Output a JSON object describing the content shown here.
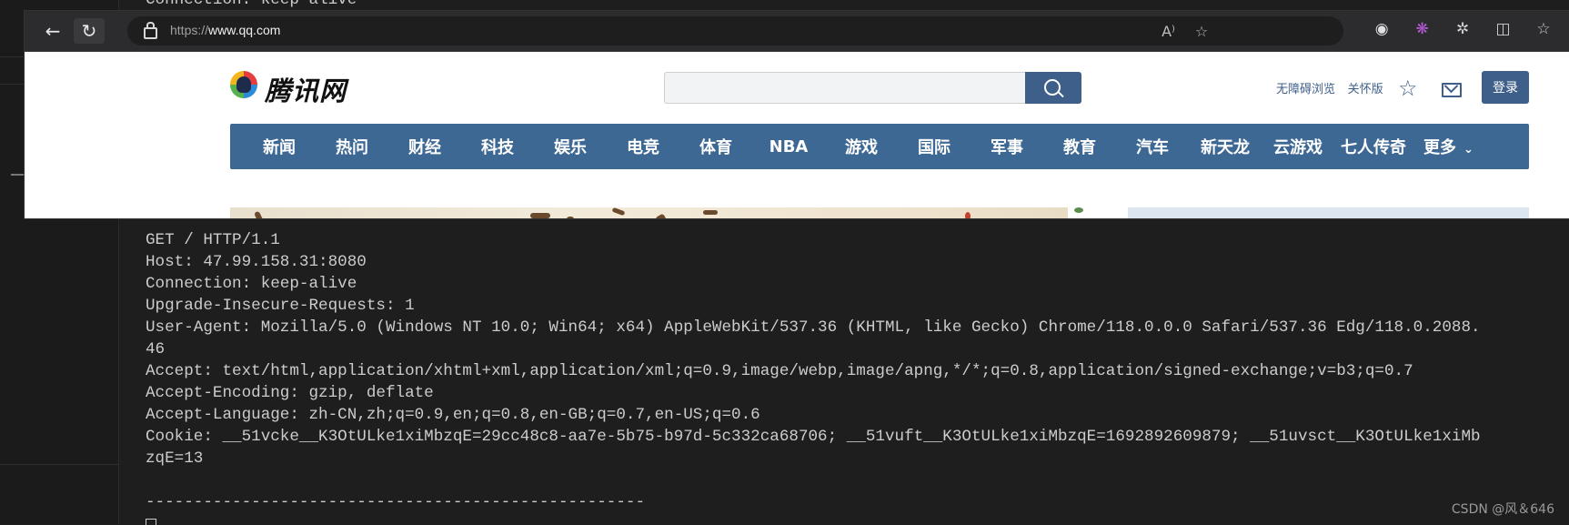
{
  "terminal": {
    "ghost_line": "Connection: keep-alive",
    "lines": [
      "----------------------------------------------------",
      "GET / HTTP/1.1",
      "Host: 47.99.158.31:8080",
      "Connection: keep-alive",
      "Upgrade-Insecure-Requests: 1",
      "User-Agent: Mozilla/5.0 (Windows NT 10.0; Win64; x64) AppleWebKit/537.36 (KHTML, like Gecko) Chrome/118.0.0.0 Safari/537.36 Edg/118.0.2088.",
      "46",
      "Accept: text/html,application/xhtml+xml,application/xml;q=0.9,image/webp,image/apng,*/*;q=0.8,application/signed-exchange;v=b3;q=0.7",
      "Accept-Encoding: gzip, deflate",
      "Accept-Language: zh-CN,zh;q=0.9,en;q=0.8,en-GB;q=0.7,en-US;q=0.6",
      "Cookie: __51vcke__K3OtULke1xiMbzqE=29cc48c8-aa7e-5b75-b97d-5c332ca68706; __51vuft__K3OtULke1xiMbzqE=1692892609879; __51uvsct__K3OtULke1xiMb",
      "zqE=13",
      "",
      "----------------------------------------------------"
    ],
    "watermark": "CSDN @风＆646"
  },
  "browser": {
    "back_glyph": "←",
    "refresh_glyph": "↻",
    "url_scheme": "https://",
    "url_host": "www.qq.com",
    "url_icons": [
      "A⁾",
      "☆"
    ],
    "toolbar_icons": [
      "◉",
      "❋",
      "✲",
      "◫",
      "☆"
    ]
  },
  "site": {
    "logo_text": "腾讯网",
    "search_placeholder": "",
    "links": [
      "无障碍浏览",
      "关怀版"
    ],
    "login_label": "登录",
    "nav": [
      "新闻",
      "热问",
      "财经",
      "科技",
      "娱乐",
      "电竞",
      "体育",
      "NBA",
      "游戏",
      "国际",
      "军事",
      "教育",
      "汽车",
      "新天龙",
      "云游戏",
      "七人传奇"
    ],
    "more_label": "更多",
    "more_chevron": "⌄"
  },
  "colors": {
    "site_accent": "#3e6894",
    "terminal_bg": "#1e1e1e",
    "terminal_text": "#cccccc"
  }
}
